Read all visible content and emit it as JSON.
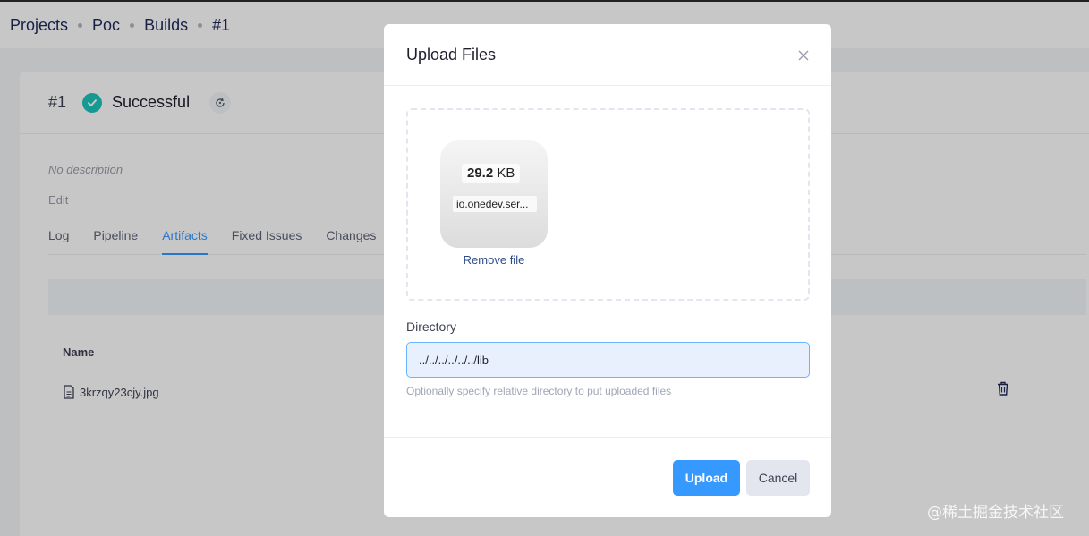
{
  "breadcrumb": [
    "Projects",
    "Poc",
    "Builds",
    "#1"
  ],
  "build": {
    "number": "#1",
    "status": "Successful",
    "description": "No description",
    "edit_label": "Edit"
  },
  "tabs": [
    "Log",
    "Pipeline",
    "Artifacts",
    "Fixed Issues",
    "Changes"
  ],
  "active_tab": "Artifacts",
  "artifacts": {
    "column_name": "Name",
    "files": [
      "3krzqy23cjy.jpg"
    ]
  },
  "modal": {
    "title": "Upload Files",
    "file": {
      "size_value": "29.2",
      "size_unit": "KB",
      "name": "io.onedev.ser...",
      "remove_label": "Remove file"
    },
    "directory_label": "Directory",
    "directory_value": "../../../../../../lib",
    "hint": "Optionally specify relative directory to put uploaded files",
    "upload_label": "Upload",
    "cancel_label": "Cancel"
  },
  "watermark": "@稀土掘金技术社区",
  "colors": {
    "primary": "#3699ff",
    "success": "#1bc5bd",
    "breadcrumb": "#1f2a5a"
  }
}
